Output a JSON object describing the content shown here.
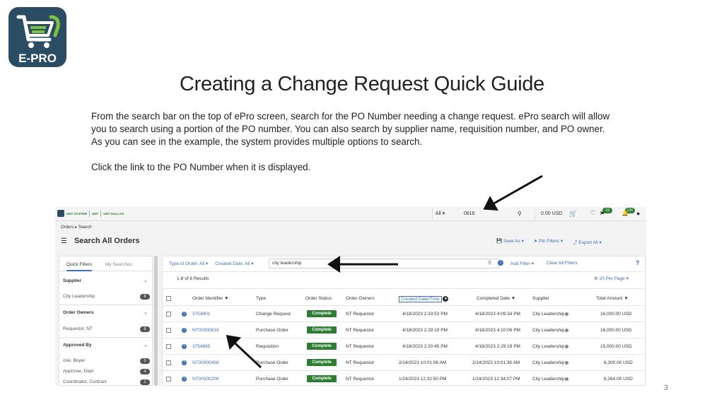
{
  "slide": {
    "logo_text": "E-PRO",
    "title": "Creating a Change Request Quick Guide",
    "para1": "From the search bar on the top of ePro screen, search for the PO Number needing a change request. ePro search will allow you to search using a portion of the PO number. You can also search by supplier name, requisition number, and PO owner. As you can see in the example, the system provides multiple options to search.",
    "para2": "Click the link to the PO Number when it is displayed.",
    "page_number": "3"
  },
  "topbar": {
    "search_scope": "All ▾",
    "search_value": "0616",
    "cart_amount": "0.00 USD",
    "favorites_badge": "19",
    "notifications_badge": "12K"
  },
  "breadcrumb": {
    "item1": "Orders",
    "sep": "▸",
    "item2": "Search"
  },
  "page": {
    "title": "Search All Orders",
    "save_as": "Save As",
    "pin_filters": "Pin Filters",
    "export_all": "Export All"
  },
  "filters_panel": {
    "tab_quick": "Quick Filters",
    "tab_my": "My Searches",
    "sections": [
      {
        "title": "Supplier",
        "items": [
          {
            "label": "City Leadership",
            "count": "8"
          }
        ]
      },
      {
        "title": "Order Owners",
        "items": [
          {
            "label": "Requestor, NT",
            "count": "8"
          }
        ]
      },
      {
        "title": "Approved By",
        "items": [
          {
            "label": "one, Buyer",
            "count": "5"
          },
          {
            "label": "Approver, Dept",
            "count": "4"
          },
          {
            "label": "Coordinator, Contract",
            "count": "1"
          }
        ]
      }
    ]
  },
  "results": {
    "filter_type": "Type of Order: All ▾",
    "filter_date": "Created Date: All ▾",
    "search_value": "city leadership",
    "add_filter": "Add Filter ▾",
    "clear_filters": "Clear All Filters",
    "help": "?",
    "count_text": "1-8 of 8 Results",
    "per_page": "20 Per Page ▾",
    "columns": {
      "order_identifier": "Order Identifier",
      "type": "Type",
      "order_status": "Order Status",
      "order_owners": "Order Owners",
      "created": "Created Date/Time",
      "completed": "Completed Date",
      "supplier": "Supplier",
      "total": "Total Amount"
    },
    "rows": [
      {
        "id": "3754901",
        "type": "Change Request",
        "status": "Complete",
        "owner": "NT Requestor",
        "created": "4/18/2023  2:33:53 PM",
        "completed": "4/18/2023  4:09:34 PM",
        "supplier": "City Leadership",
        "total": "16,000.00  USD"
      },
      {
        "id": "NT00000616",
        "type": "Purchase Order",
        "status": "Complete",
        "owner": "NT Requestor",
        "created": "4/18/2023  2:29:19 PM",
        "completed": "4/18/2023  4:10:06 PM",
        "supplier": "City Leadership",
        "total": "16,000.00  USD"
      },
      {
        "id": "3754865",
        "type": "Requisition",
        "status": "Complete",
        "owner": "NT Requestor",
        "created": "4/18/2023  2:20:45 PM",
        "completed": "4/18/2023  2:29:19 PM",
        "supplier": "City Leadership",
        "total": "15,000.00  USD"
      },
      {
        "id": "NT00000458",
        "type": "Purchase Order",
        "status": "Complete",
        "owner": "NT Requestor",
        "created": "2/14/2023  10:01:06 AM",
        "completed": "2/14/2023  10:01:36 AM",
        "supplier": "City Leadership",
        "total": "6,300.00  USD"
      },
      {
        "id": "NT00000206",
        "type": "Purchase Order",
        "status": "Complete",
        "owner": "NT Requestor",
        "created": "1/24/2023  12:32:50 PM",
        "completed": "1/24/2023  12:34:07 PM",
        "supplier": "City Leadership",
        "total": "6,264.00  USD"
      }
    ]
  }
}
